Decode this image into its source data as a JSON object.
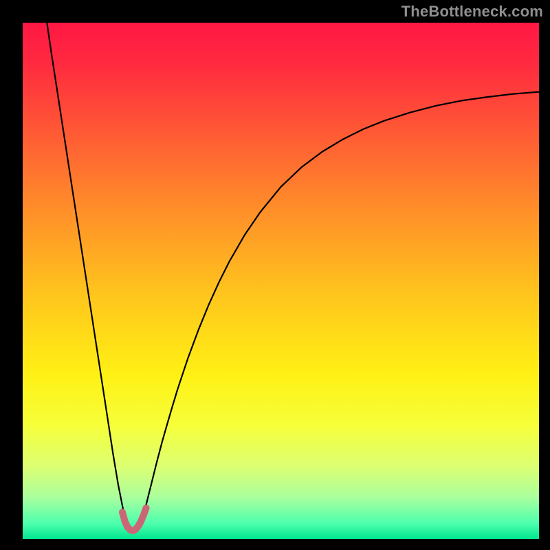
{
  "watermark": "TheBottleneck.com",
  "chart_data": {
    "type": "line",
    "title": "",
    "xlabel": "",
    "ylabel": "",
    "xlim": [
      0,
      100
    ],
    "ylim": [
      0,
      100
    ],
    "grid": false,
    "legend": false,
    "background_gradient": {
      "stops": [
        {
          "offset": 0.0,
          "color": "#ff1744"
        },
        {
          "offset": 0.08,
          "color": "#ff2a3f"
        },
        {
          "offset": 0.2,
          "color": "#ff5536"
        },
        {
          "offset": 0.35,
          "color": "#ff8a2a"
        },
        {
          "offset": 0.52,
          "color": "#ffc31d"
        },
        {
          "offset": 0.68,
          "color": "#fff014"
        },
        {
          "offset": 0.78,
          "color": "#f6ff3a"
        },
        {
          "offset": 0.86,
          "color": "#dcff73"
        },
        {
          "offset": 0.92,
          "color": "#a9ff9e"
        },
        {
          "offset": 0.97,
          "color": "#4dffad"
        },
        {
          "offset": 1.0,
          "color": "#00e68f"
        }
      ]
    },
    "series": [
      {
        "name": "bottleneck-curve",
        "color": "#000000",
        "width": 2.2,
        "x": [
          4.7,
          5.5,
          6.5,
          7.5,
          8.5,
          9.5,
          10.5,
          11.5,
          12.5,
          13.5,
          14.5,
          15.5,
          16.5,
          17.5,
          18.5,
          19.5,
          20.0,
          20.5,
          21.0,
          21.5,
          22.0,
          22.5,
          23.0,
          23.5,
          24.0,
          25.0,
          26.0,
          27.0,
          28.0,
          29.0,
          30.0,
          32.0,
          34.0,
          36.0,
          38.0,
          40.0,
          43.0,
          46.0,
          50.0,
          54.0,
          58.0,
          62.0,
          66.0,
          70.0,
          75.0,
          80.0,
          85.0,
          90.0,
          95.0,
          100.0
        ],
        "y": [
          100.0,
          94.5,
          88.0,
          81.5,
          75.0,
          68.5,
          62.0,
          55.5,
          49.0,
          42.5,
          36.0,
          29.5,
          23.0,
          16.5,
          10.5,
          5.5,
          3.5,
          2.0,
          1.3,
          1.2,
          1.5,
          2.3,
          3.5,
          5.0,
          7.0,
          11.0,
          15.0,
          18.8,
          22.3,
          25.7,
          29.0,
          35.0,
          40.4,
          45.3,
          49.7,
          53.7,
          58.9,
          63.3,
          68.2,
          72.0,
          75.0,
          77.4,
          79.4,
          81.0,
          82.6,
          83.9,
          84.9,
          85.6,
          86.2,
          86.6
        ]
      },
      {
        "name": "optimum-marker",
        "color": "#cc6677",
        "width": 10,
        "linecap": "round",
        "x": [
          19.3,
          19.8,
          20.3,
          20.9,
          21.4,
          21.9,
          22.4,
          22.9,
          23.4,
          23.9
        ],
        "y": [
          5.2,
          3.4,
          2.3,
          1.7,
          1.6,
          1.9,
          2.5,
          3.4,
          4.6,
          6.0
        ]
      }
    ]
  }
}
